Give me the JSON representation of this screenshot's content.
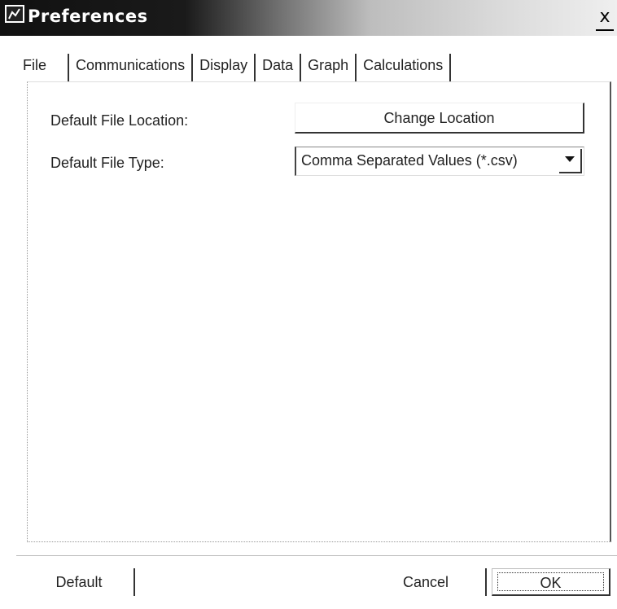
{
  "window": {
    "title": "Preferences",
    "close_label": "x"
  },
  "tabs": [
    {
      "label": "File",
      "active": true
    },
    {
      "label": "Communications",
      "active": false
    },
    {
      "label": "Display",
      "active": false
    },
    {
      "label": "Data",
      "active": false
    },
    {
      "label": "Graph",
      "active": false
    },
    {
      "label": "Calculations",
      "active": false
    }
  ],
  "file_tab": {
    "location_label": "Default File Location:",
    "change_location_label": "Change Location",
    "type_label": "Default File Type:",
    "type_value": "Comma Separated Values (*.csv)"
  },
  "footer": {
    "default_label": "Default",
    "cancel_label": "Cancel",
    "ok_label": "OK"
  },
  "icons": {
    "title_icon": "app-icon",
    "dropdown_icon": "chevron-down-icon"
  }
}
